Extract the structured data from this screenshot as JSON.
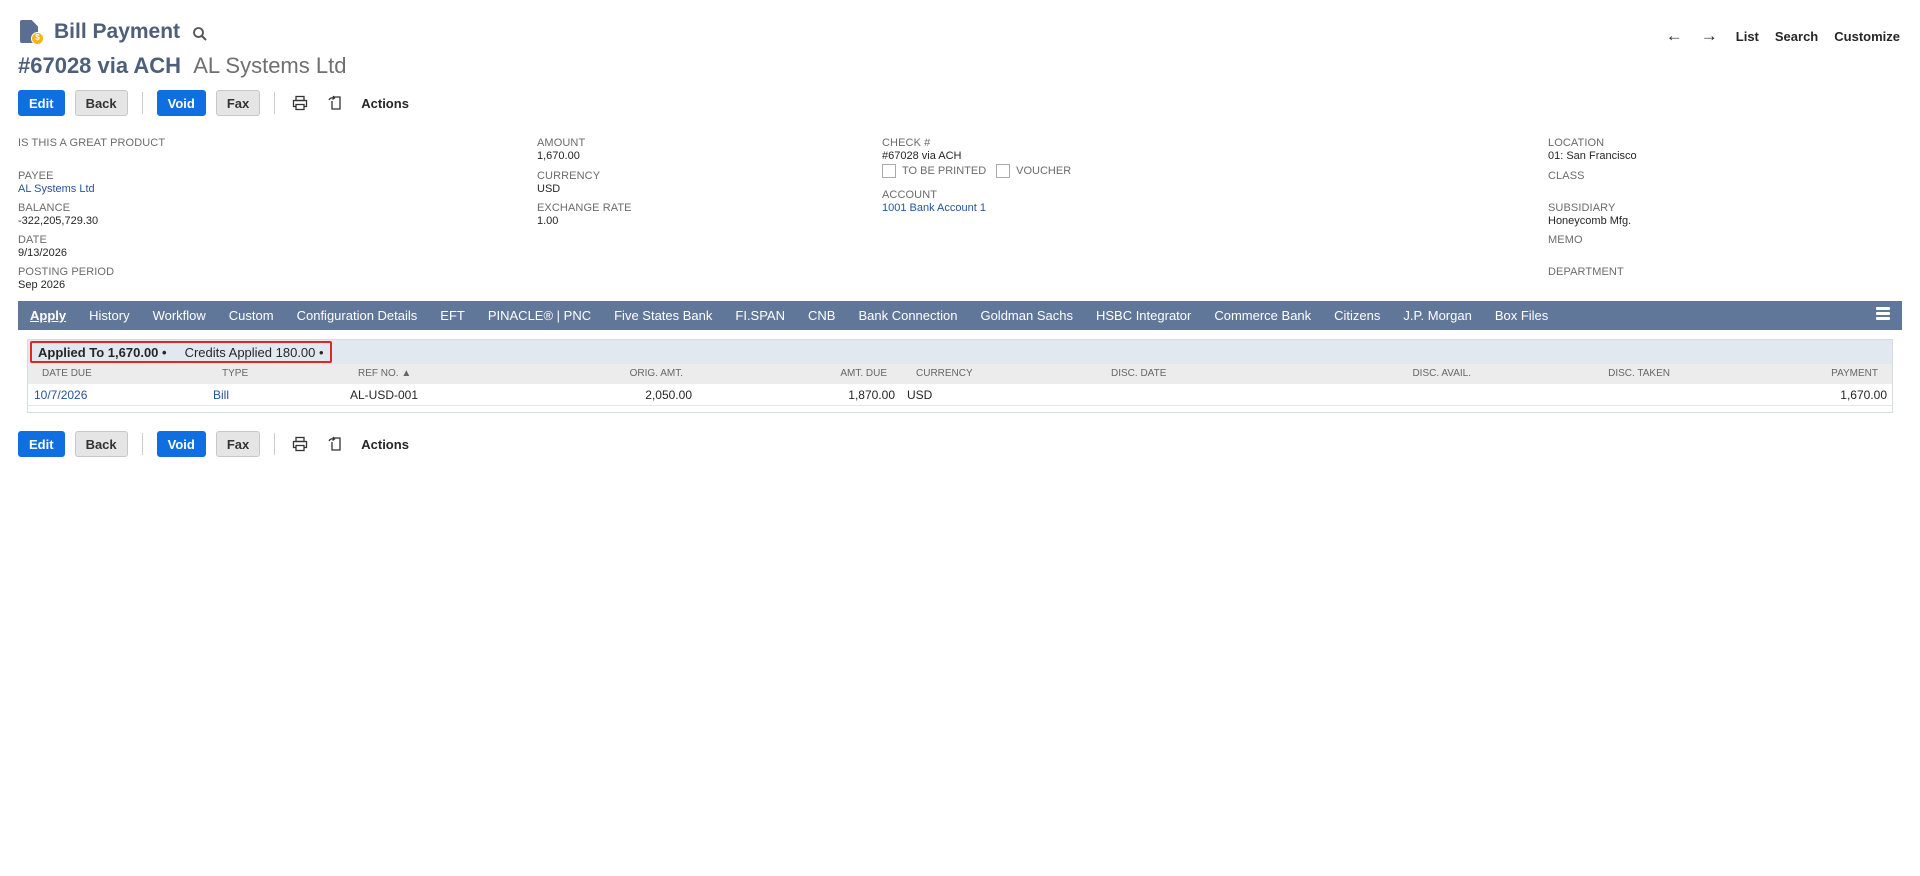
{
  "header": {
    "record_type": "Bill Payment",
    "record_number": "#67028 via ACH",
    "entity_name": "AL Systems Ltd",
    "nav": {
      "prev": "←",
      "next": "→",
      "list": "List",
      "search": "Search",
      "customize": "Customize"
    }
  },
  "buttons": {
    "edit": "Edit",
    "back": "Back",
    "void": "Void",
    "fax": "Fax",
    "actions": "Actions"
  },
  "fields": {
    "col1": [
      {
        "label": "IS THIS A GREAT PRODUCT",
        "value": ""
      },
      {
        "label": "PAYEE",
        "value": "AL Systems Ltd"
      },
      {
        "label": "BALANCE",
        "value": "-322,205,729.30"
      },
      {
        "label": "DATE",
        "value": "9/13/2026"
      },
      {
        "label": "POSTING PERIOD",
        "value": "Sep 2026"
      }
    ],
    "col2": [
      {
        "label": "AMOUNT",
        "value": "1,670.00"
      },
      {
        "label": "CURRENCY",
        "value": "USD"
      },
      {
        "label": "EXCHANGE RATE",
        "value": "1.00"
      }
    ],
    "col3": {
      "check_label": "CHECK #",
      "check_value": "#67028 via ACH",
      "to_be_printed": "TO BE PRINTED",
      "voucher": "VOUCHER",
      "account_label": "ACCOUNT",
      "account_value": "1001 Bank Account 1"
    },
    "col4": [
      {
        "label": "LOCATION",
        "value": "01: San Francisco"
      },
      {
        "label": "CLASS",
        "value": ""
      },
      {
        "label": "SUBSIDIARY",
        "value": "Honeycomb Mfg."
      },
      {
        "label": "MEMO",
        "value": ""
      },
      {
        "label": "DEPARTMENT",
        "value": ""
      }
    ]
  },
  "tabs": [
    "Apply",
    "History",
    "Workflow",
    "Custom",
    "Configuration Details",
    "EFT",
    "PINACLE® | PNC",
    "Five States Bank",
    "FI.SPAN",
    "CNB",
    "Bank Connection",
    "Goldman Sachs",
    "HSBC Integrator",
    "Commerce Bank",
    "Citizens",
    "J.P. Morgan",
    "Box Files"
  ],
  "subtabs": {
    "applied": "Applied To 1,670.00 •",
    "credits": "Credits Applied 180.00 •"
  },
  "table": {
    "headers": {
      "date_due": "DATE DUE",
      "type": "TYPE",
      "ref_no": "REF NO. ▲",
      "orig_amt": "ORIG. AMT.",
      "amt_due": "AMT. DUE",
      "currency": "CURRENCY",
      "disc_date": "DISC. DATE",
      "disc_avail": "DISC. AVAIL.",
      "disc_taken": "DISC. TAKEN",
      "payment": "PAYMENT"
    },
    "rows": [
      {
        "date_due": "10/7/2026",
        "type": "Bill",
        "ref_no": "AL-USD-001",
        "orig_amt": "2,050.00",
        "amt_due": "1,870.00",
        "currency": "USD",
        "disc_date": "",
        "disc_avail": "",
        "disc_taken": "",
        "payment": "1,670.00"
      }
    ]
  }
}
